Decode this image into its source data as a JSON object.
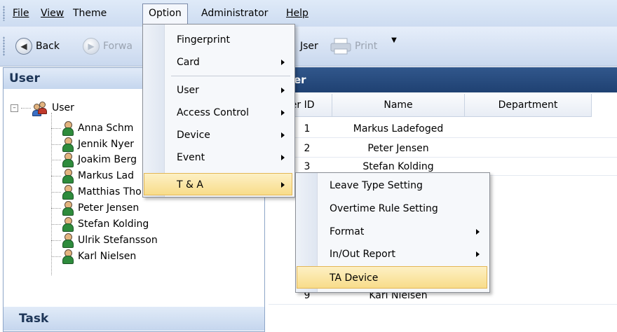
{
  "menubar": {
    "items": [
      {
        "label": "File"
      },
      {
        "label": "View"
      },
      {
        "label": "Theme"
      },
      {
        "label": "Option"
      },
      {
        "label": "Administrator"
      },
      {
        "label": "Help"
      }
    ]
  },
  "toolbar": {
    "back": "Back",
    "forward": "Forwa",
    "user_partial": "Jser",
    "print": "Print"
  },
  "left_panel": {
    "header": "User",
    "tree_root": "User",
    "users": [
      "Anna Schm",
      "Jennik Nyer",
      "Joakim Berg",
      "Markus Lad",
      "Matthias Thomsen",
      "Peter Jensen",
      "Stefan Kolding",
      "Ulrik Stefansson",
      "Karl Nielsen"
    ],
    "task_header": "Task"
  },
  "grid": {
    "title": "er",
    "columns": [
      "ser ID",
      "Name",
      "Department"
    ],
    "rows": [
      {
        "id": "1",
        "name": "Markus Ladefoged"
      },
      {
        "id": "2",
        "name": "Peter Jensen"
      },
      {
        "id": "3",
        "name": "Stefan Kolding"
      },
      {
        "id": "9",
        "name": "Karl Nielsen"
      }
    ]
  },
  "option_menu": {
    "items": [
      "Fingerprint",
      "Card",
      "User",
      "Access Control",
      "Device",
      "Event",
      "T & A"
    ]
  },
  "ta_submenu": {
    "items": [
      "Leave Type Setting",
      "Overtime Rule Setting",
      "Format",
      "In/Out Report",
      "TA Device"
    ]
  },
  "colors": {
    "menubar": "#d7e3f5",
    "grid_title": "#294c80",
    "highlight": "#f9df92"
  }
}
